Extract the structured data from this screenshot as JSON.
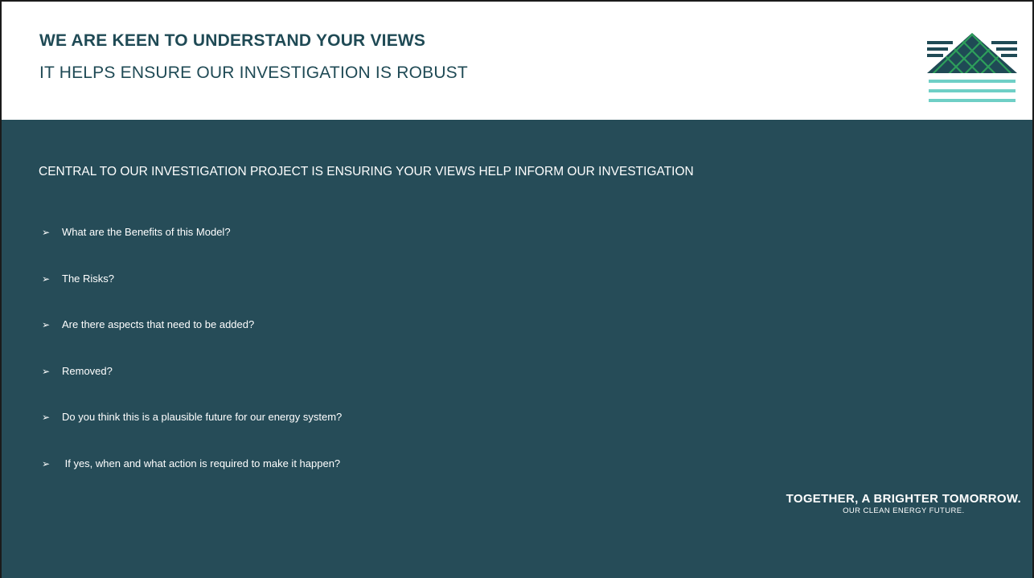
{
  "header": {
    "title": "WE ARE KEEN TO UNDERSTAND YOUR VIEWS",
    "subtitle": "IT HELPS ENSURE OUR INVESTIGATION IS ROBUST",
    "logo_icon": "pyramid-waves-logo-icon"
  },
  "content": {
    "lead": "CENTRAL TO OUR INVESTIGATION PROJECT IS ENSURING YOUR VIEWS HELP INFORM OUR INVESTIGATION",
    "bullet_glyph": "➢",
    "bullets": [
      "What are the Benefits of this Model?",
      "The Risks?",
      "Are there aspects that need to be added?",
      "Removed?",
      "Do you think this is a plausible future for our energy system?",
      " If yes, when and what action is required to make it happen?"
    ]
  },
  "footer": {
    "tagline_main": "TOGETHER, A BRIGHTER TOMORROW.",
    "tagline_sub": "OUR CLEAN ENERGY FUTURE."
  },
  "colors": {
    "header_text": "#1f4a55",
    "body_background": "#264c58",
    "logo_dark": "#1f4a55",
    "logo_green": "#2e9e5b",
    "logo_teal": "#6fcfc6"
  }
}
